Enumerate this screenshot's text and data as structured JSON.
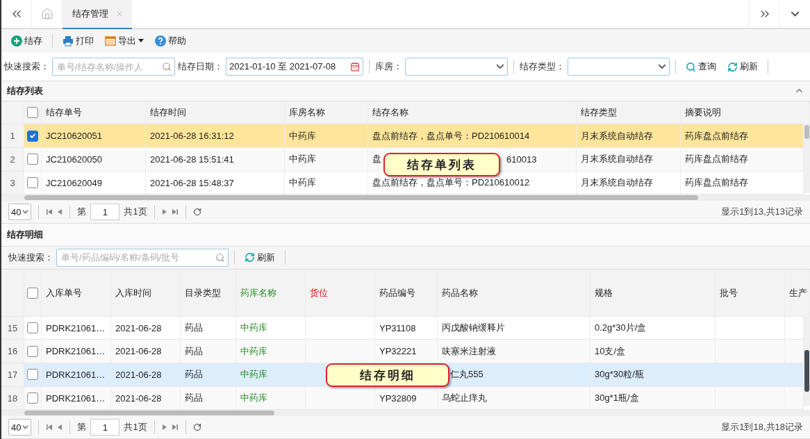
{
  "tabs": [
    {
      "label": "结存管理",
      "selected": true
    }
  ],
  "toolbar": [
    {
      "kind": "add",
      "label": "结存",
      "has_menu": false
    },
    {
      "kind": "print",
      "label": "打印",
      "has_menu": false
    },
    {
      "kind": "export",
      "label": "导出",
      "has_menu": true
    },
    {
      "kind": "help",
      "label": "帮助",
      "has_menu": false
    }
  ],
  "filters": {
    "search_label": "快速搜索：",
    "search_placeholder": "单号/结存名称/操作人",
    "date_label": "结存日期：",
    "date_value": "2021-01-10 至 2021-07-08",
    "store_label": "库房：",
    "type_label": "结存类型：",
    "query_button": "查询",
    "refresh_button": "刷新"
  },
  "list_panel": {
    "title": "结存列表",
    "header_checked": false,
    "columns": [
      {
        "label": "结存单号"
      },
      {
        "label": "结存时间"
      },
      {
        "label": "库房名称"
      },
      {
        "label": "结存名称"
      },
      {
        "label": "结存类型"
      },
      {
        "label": "摘要说明"
      }
    ],
    "rows": [
      {
        "index": "1",
        "selected": true,
        "cells": [
          "JC210620051",
          "2021-06-28 16:31:12",
          "中药库",
          "盘点前结存，盘点单号：PD210610014",
          "月末系统自动结存",
          "药库盘点前结存"
        ]
      },
      {
        "index": "2",
        "selected": false,
        "cells": [
          "JC210620050",
          "2021-06-28 15:51:41",
          "中药库",
          {
            "before": "盘",
            "after": "610013"
          },
          "月末系统自动结存",
          "药库盘点前结存"
        ]
      },
      {
        "index": "3",
        "selected": false,
        "cells": [
          "JC210620049",
          "2021-06-28 15:48:37",
          "中药库",
          "盘点前结存，盘点单号：PD210610012",
          "月末系统自动结存",
          "药库盘点前结存"
        ]
      }
    ],
    "pager": {
      "page_size": "40",
      "page_prefix": "第",
      "page": "1",
      "page_suffix": "共1页",
      "summary": "显示1到13,共13记录"
    },
    "callout": "结存单列表"
  },
  "detail_panel": {
    "title": "结存明细",
    "search_label": "快速搜索：",
    "search_placeholder": "单号/药品编码/名称/条码/批号",
    "refresh_button": "刷新",
    "header_checked": false,
    "columns": [
      {
        "label": "入库单号"
      },
      {
        "label": "入库时间"
      },
      {
        "label": "目录类型"
      },
      {
        "label": "药库名称",
        "color": "#1a8a1a"
      },
      {
        "label": "货位",
        "color": "#dd1111"
      },
      {
        "label": "药品编号"
      },
      {
        "label": "药品名称"
      },
      {
        "label": "规格"
      },
      {
        "label": "批号"
      },
      {
        "label": "生产"
      }
    ],
    "rows": [
      {
        "index": "15",
        "checked": false,
        "highlighted": false,
        "cells": [
          "PDRK21061…",
          "2021-06-28",
          "药品",
          "中药库",
          null,
          "YP31108",
          "丙戊酸钠缓释片",
          "0.2g*30片/盒",
          null,
          null
        ]
      },
      {
        "index": "16",
        "checked": false,
        "highlighted": false,
        "cells": [
          "PDRK21061…",
          "2021-06-28",
          "药品",
          "中药库",
          null,
          "YP32221",
          "呋塞米注射液",
          "10支/盒",
          null,
          null
        ]
      },
      {
        "index": "17",
        "checked": false,
        "highlighted": true,
        "cells": [
          "PDRK21061…",
          "2021-06-28",
          "药品",
          "中药库",
          null,
          null,
          {
            "after": "仁丸555"
          },
          "30g*30粒/瓶",
          null,
          null
        ]
      },
      {
        "index": "18",
        "checked": false,
        "highlighted": false,
        "cells": [
          "PDRK21061…",
          "2021-06-28",
          "药品",
          "中药库",
          null,
          "YP32809",
          "乌蛇止痒丸",
          "30g*1瓶/盒",
          null,
          null
        ]
      }
    ],
    "pager": {
      "page_size": "40",
      "page_prefix": "第",
      "page": "1",
      "page_suffix": "共1页",
      "summary": "显示1到18,共18记录"
    },
    "callout": "结存明细"
  }
}
